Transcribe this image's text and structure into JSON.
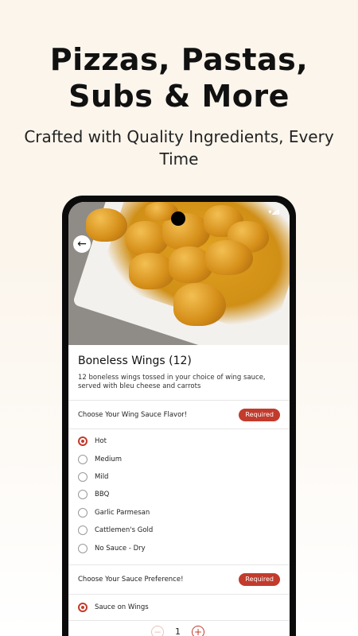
{
  "promo": {
    "title_line1": "Pizzas, Pastas,",
    "title_line2": "Subs & More",
    "subtitle": "Crafted with Quality Ingredients, Every Time"
  },
  "status_bar": {
    "time": "",
    "icons": "▾◢▮"
  },
  "nav": {
    "back_icon": "arrow-left-icon"
  },
  "item": {
    "title": "Boneless Wings (12)",
    "description": "12 boneless wings tossed in your choice of wing sauce, served with bleu cheese and carrots"
  },
  "groups": [
    {
      "label": "Choose Your Wing Sauce Flavor!",
      "badge": "Required",
      "options": [
        {
          "label": "Hot",
          "selected": true
        },
        {
          "label": "Medium",
          "selected": false
        },
        {
          "label": "Mild",
          "selected": false
        },
        {
          "label": "BBQ",
          "selected": false
        },
        {
          "label": "Garlic Parmesan",
          "selected": false
        },
        {
          "label": "Cattlemen's Gold",
          "selected": false
        },
        {
          "label": "No Sauce - Dry",
          "selected": false
        }
      ]
    },
    {
      "label": "Choose Your Sauce Preference!",
      "badge": "Required",
      "options": [
        {
          "label": "Sauce on Wings",
          "selected": true
        }
      ]
    }
  ],
  "quantity": {
    "value": "1",
    "minus": "−",
    "plus": "+"
  },
  "colors": {
    "accent": "#c23b2c",
    "background": "#fbf5ec"
  }
}
